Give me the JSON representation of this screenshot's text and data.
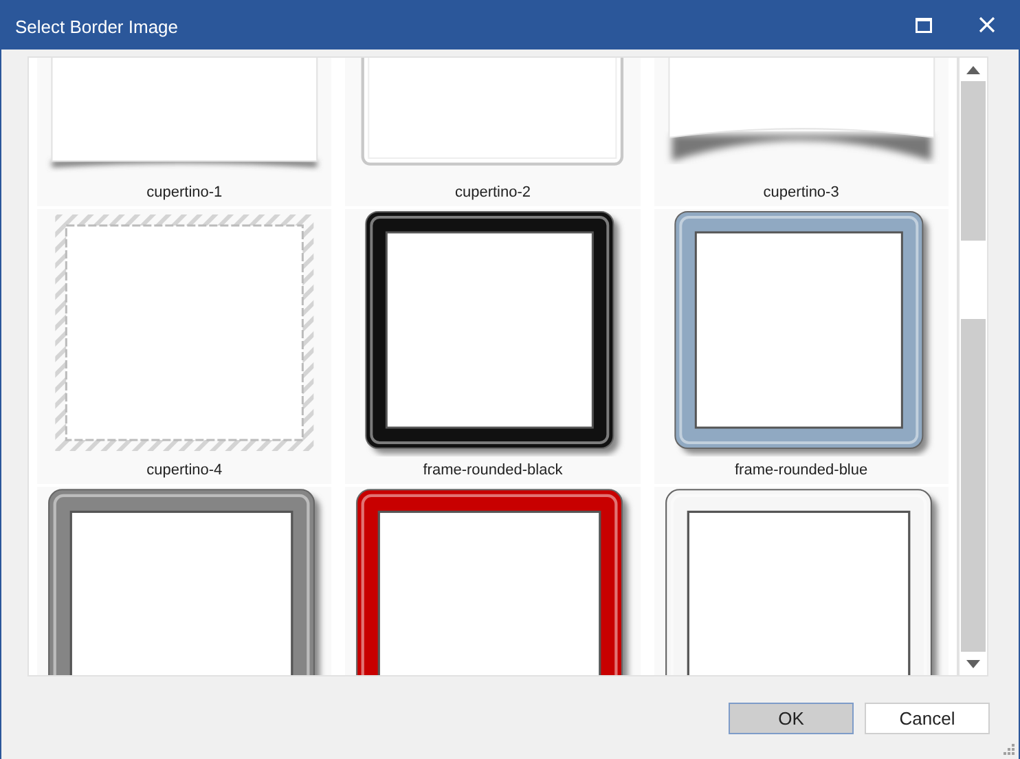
{
  "window": {
    "title": "Select Border Image"
  },
  "items": [
    {
      "label": "cupertino-1",
      "kind": "shadow"
    },
    {
      "label": "cupertino-2",
      "kind": "inset"
    },
    {
      "label": "cupertino-3",
      "kind": "curl"
    },
    {
      "label": "cupertino-4",
      "kind": "hatched"
    },
    {
      "label": "frame-rounded-black",
      "kind": "frame",
      "color": "#111111"
    },
    {
      "label": "frame-rounded-blue",
      "kind": "frame",
      "color": "#90a9c2"
    },
    {
      "kind": "frame",
      "color": "#858585"
    },
    {
      "kind": "frame",
      "color": "#c80000"
    },
    {
      "kind": "frame",
      "color": "#f6f6f6"
    }
  ],
  "buttons": [
    {
      "label": "OK",
      "default": true
    },
    {
      "label": "Cancel",
      "default": false
    }
  ]
}
